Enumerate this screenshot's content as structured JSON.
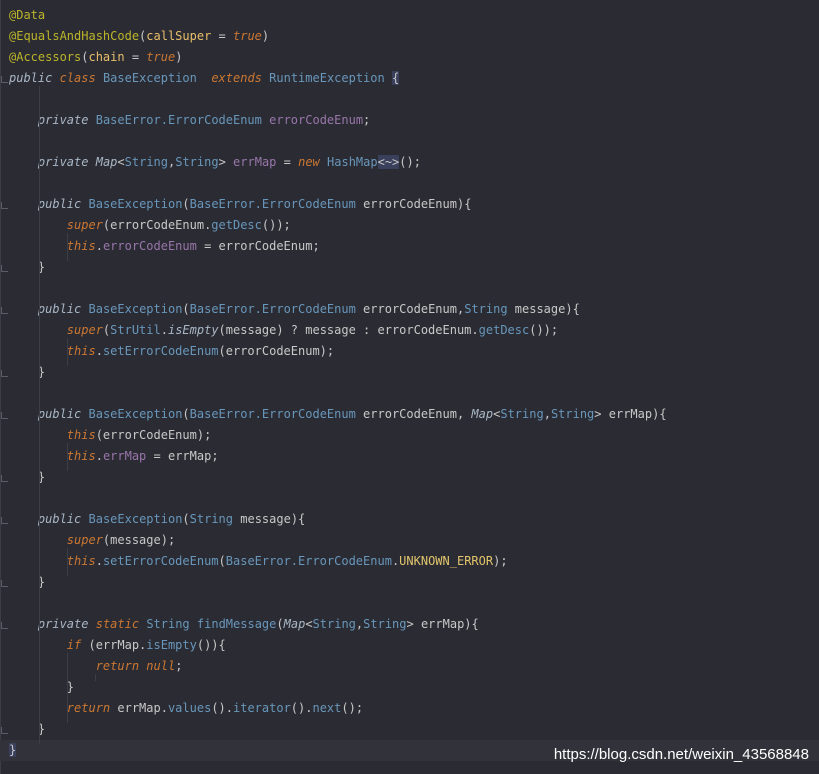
{
  "editor": {
    "lines": [
      [
        {
          "t": "@Data",
          "c": "ann"
        }
      ],
      [
        {
          "t": "@EqualsAndHashCode",
          "c": "ann"
        },
        {
          "t": "(",
          "c": "punc"
        },
        {
          "t": "callSuper",
          "c": "par"
        },
        {
          "t": " = ",
          "c": "punc"
        },
        {
          "t": "true",
          "c": "kw"
        },
        {
          "t": ")",
          "c": "punc"
        }
      ],
      [
        {
          "t": "@Accessors",
          "c": "ann"
        },
        {
          "t": "(",
          "c": "punc"
        },
        {
          "t": "chain",
          "c": "par"
        },
        {
          "t": " = ",
          "c": "punc"
        },
        {
          "t": "true",
          "c": "kw"
        },
        {
          "t": ")",
          "c": "punc"
        }
      ],
      [
        {
          "t": "public",
          "c": "mod"
        },
        {
          "t": " ",
          "c": "punc"
        },
        {
          "t": "class",
          "c": "kw"
        },
        {
          "t": " ",
          "c": "punc"
        },
        {
          "t": "BaseException",
          "c": "type"
        },
        {
          "t": "  ",
          "c": "punc"
        },
        {
          "t": "extends",
          "c": "kw"
        },
        {
          "t": " ",
          "c": "punc"
        },
        {
          "t": "RuntimeException",
          "c": "type"
        },
        {
          "t": " ",
          "c": "punc"
        },
        {
          "t": "{",
          "c": "hl"
        }
      ],
      [],
      [
        {
          "t": "    ",
          "c": "punc"
        },
        {
          "t": "private",
          "c": "mod"
        },
        {
          "t": " ",
          "c": "punc"
        },
        {
          "t": "BaseError.ErrorCodeEnum",
          "c": "type"
        },
        {
          "t": " ",
          "c": "punc"
        },
        {
          "t": "errorCodeEnum",
          "c": "field"
        },
        {
          "t": ";",
          "c": "punc"
        }
      ],
      [],
      [
        {
          "t": "    ",
          "c": "punc"
        },
        {
          "t": "private",
          "c": "mod"
        },
        {
          "t": " ",
          "c": "punc"
        },
        {
          "t": "Map",
          "c": "ital"
        },
        {
          "t": "<",
          "c": "punc"
        },
        {
          "t": "String",
          "c": "type"
        },
        {
          "t": ",",
          "c": "punc"
        },
        {
          "t": "String",
          "c": "type"
        },
        {
          "t": "> ",
          "c": "punc"
        },
        {
          "t": "errMap",
          "c": "field"
        },
        {
          "t": " = ",
          "c": "punc"
        },
        {
          "t": "new",
          "c": "kw"
        },
        {
          "t": " ",
          "c": "punc"
        },
        {
          "t": "HashMap",
          "c": "type"
        },
        {
          "t": "<~>",
          "c": "hl"
        },
        {
          "t": "();",
          "c": "punc"
        }
      ],
      [],
      [
        {
          "t": "    ",
          "c": "punc"
        },
        {
          "t": "public",
          "c": "mod"
        },
        {
          "t": " ",
          "c": "punc"
        },
        {
          "t": "BaseException",
          "c": "fn"
        },
        {
          "t": "(",
          "c": "punc"
        },
        {
          "t": "BaseError.ErrorCodeEnum",
          "c": "type"
        },
        {
          "t": " ",
          "c": "punc"
        },
        {
          "t": "errorCodeEnum",
          "c": "plain"
        },
        {
          "t": "){",
          "c": "punc"
        }
      ],
      [
        {
          "t": "        ",
          "c": "punc"
        },
        {
          "t": "super",
          "c": "kw"
        },
        {
          "t": "(errorCodeEnum.",
          "c": "punc"
        },
        {
          "t": "getDesc",
          "c": "fn"
        },
        {
          "t": "());",
          "c": "punc"
        }
      ],
      [
        {
          "t": "        ",
          "c": "punc"
        },
        {
          "t": "this",
          "c": "kw"
        },
        {
          "t": ".",
          "c": "punc"
        },
        {
          "t": "errorCodeEnum",
          "c": "field"
        },
        {
          "t": " = errorCodeEnum;",
          "c": "punc"
        }
      ],
      [
        {
          "t": "    }",
          "c": "punc"
        }
      ],
      [],
      [
        {
          "t": "    ",
          "c": "punc"
        },
        {
          "t": "public",
          "c": "mod"
        },
        {
          "t": " ",
          "c": "punc"
        },
        {
          "t": "BaseException",
          "c": "fn"
        },
        {
          "t": "(",
          "c": "punc"
        },
        {
          "t": "BaseError.ErrorCodeEnum",
          "c": "type"
        },
        {
          "t": " errorCodeEnum,",
          "c": "plain"
        },
        {
          "t": "String",
          "c": "type"
        },
        {
          "t": " message){",
          "c": "plain"
        }
      ],
      [
        {
          "t": "        ",
          "c": "punc"
        },
        {
          "t": "super",
          "c": "kw"
        },
        {
          "t": "(",
          "c": "punc"
        },
        {
          "t": "StrUtil",
          "c": "type"
        },
        {
          "t": ".",
          "c": "punc"
        },
        {
          "t": "isEmpty",
          "c": "ital"
        },
        {
          "t": "(message) ? message : errorCodeEnum.",
          "c": "punc"
        },
        {
          "t": "getDesc",
          "c": "fn"
        },
        {
          "t": "());",
          "c": "punc"
        }
      ],
      [
        {
          "t": "        ",
          "c": "punc"
        },
        {
          "t": "this",
          "c": "kw"
        },
        {
          "t": ".",
          "c": "punc"
        },
        {
          "t": "setErrorCodeEnum",
          "c": "fn"
        },
        {
          "t": "(errorCodeEnum);",
          "c": "punc"
        }
      ],
      [
        {
          "t": "    }",
          "c": "punc"
        }
      ],
      [],
      [
        {
          "t": "    ",
          "c": "punc"
        },
        {
          "t": "public",
          "c": "mod"
        },
        {
          "t": " ",
          "c": "punc"
        },
        {
          "t": "BaseException",
          "c": "fn"
        },
        {
          "t": "(",
          "c": "punc"
        },
        {
          "t": "BaseError.ErrorCodeEnum",
          "c": "type"
        },
        {
          "t": " errorCodeEnum, ",
          "c": "plain"
        },
        {
          "t": "Map",
          "c": "ital"
        },
        {
          "t": "<",
          "c": "punc"
        },
        {
          "t": "String",
          "c": "type"
        },
        {
          "t": ",",
          "c": "punc"
        },
        {
          "t": "String",
          "c": "type"
        },
        {
          "t": "> errMap){",
          "c": "punc"
        }
      ],
      [
        {
          "t": "        ",
          "c": "punc"
        },
        {
          "t": "this",
          "c": "kw"
        },
        {
          "t": "(errorCodeEnum);",
          "c": "punc"
        }
      ],
      [
        {
          "t": "        ",
          "c": "punc"
        },
        {
          "t": "this",
          "c": "kw"
        },
        {
          "t": ".",
          "c": "punc"
        },
        {
          "t": "errMap",
          "c": "field"
        },
        {
          "t": " = errMap;",
          "c": "punc"
        }
      ],
      [
        {
          "t": "    }",
          "c": "punc"
        }
      ],
      [],
      [
        {
          "t": "    ",
          "c": "punc"
        },
        {
          "t": "public",
          "c": "mod"
        },
        {
          "t": " ",
          "c": "punc"
        },
        {
          "t": "BaseException",
          "c": "fn"
        },
        {
          "t": "(",
          "c": "punc"
        },
        {
          "t": "String",
          "c": "type"
        },
        {
          "t": " message){",
          "c": "plain"
        }
      ],
      [
        {
          "t": "        ",
          "c": "punc"
        },
        {
          "t": "super",
          "c": "kw"
        },
        {
          "t": "(message);",
          "c": "punc"
        }
      ],
      [
        {
          "t": "        ",
          "c": "punc"
        },
        {
          "t": "this",
          "c": "kw"
        },
        {
          "t": ".",
          "c": "punc"
        },
        {
          "t": "setErrorCodeEnum",
          "c": "fn"
        },
        {
          "t": "(",
          "c": "punc"
        },
        {
          "t": "BaseError.ErrorCodeEnum",
          "c": "type"
        },
        {
          "t": ".",
          "c": "punc"
        },
        {
          "t": "UNKNOWN_ERROR",
          "c": "const"
        },
        {
          "t": ");",
          "c": "punc"
        }
      ],
      [
        {
          "t": "    }",
          "c": "punc"
        }
      ],
      [],
      [
        {
          "t": "    ",
          "c": "punc"
        },
        {
          "t": "private",
          "c": "mod"
        },
        {
          "t": " ",
          "c": "punc"
        },
        {
          "t": "static",
          "c": "kw"
        },
        {
          "t": " ",
          "c": "punc"
        },
        {
          "t": "String",
          "c": "type"
        },
        {
          "t": " ",
          "c": "punc"
        },
        {
          "t": "findMessage",
          "c": "fn"
        },
        {
          "t": "(",
          "c": "punc"
        },
        {
          "t": "Map",
          "c": "ital"
        },
        {
          "t": "<",
          "c": "punc"
        },
        {
          "t": "String",
          "c": "type"
        },
        {
          "t": ",",
          "c": "punc"
        },
        {
          "t": "String",
          "c": "type"
        },
        {
          "t": "> errMap){",
          "c": "punc"
        }
      ],
      [
        {
          "t": "        ",
          "c": "punc"
        },
        {
          "t": "if",
          "c": "kw"
        },
        {
          "t": " (errMap.",
          "c": "punc"
        },
        {
          "t": "isEmpty",
          "c": "fn"
        },
        {
          "t": "()){",
          "c": "punc"
        }
      ],
      [
        {
          "t": "            ",
          "c": "punc"
        },
        {
          "t": "return",
          "c": "kw"
        },
        {
          "t": " ",
          "c": "punc"
        },
        {
          "t": "null",
          "c": "kw"
        },
        {
          "t": ";",
          "c": "punc"
        }
      ],
      [
        {
          "t": "        }",
          "c": "punc"
        }
      ],
      [
        {
          "t": "        ",
          "c": "punc"
        },
        {
          "t": "return",
          "c": "kw"
        },
        {
          "t": " errMap.",
          "c": "punc"
        },
        {
          "t": "values",
          "c": "fn"
        },
        {
          "t": "().",
          "c": "punc"
        },
        {
          "t": "iterator",
          "c": "fn"
        },
        {
          "t": "().",
          "c": "punc"
        },
        {
          "t": "next",
          "c": "fn"
        },
        {
          "t": "();",
          "c": "punc"
        }
      ],
      [
        {
          "t": "    }",
          "c": "punc"
        }
      ],
      [
        {
          "t": "}",
          "c": "hl"
        }
      ]
    ],
    "current_line": 35
  },
  "watermark": "https://blog.csdn.net/weixin_43568848",
  "colors": {
    "background": "#2b2b33",
    "annotation": "#bbb529",
    "keyword": "#cc7832",
    "type": "#6897bb",
    "field": "#9876aa",
    "constant": "#e0c46c"
  }
}
